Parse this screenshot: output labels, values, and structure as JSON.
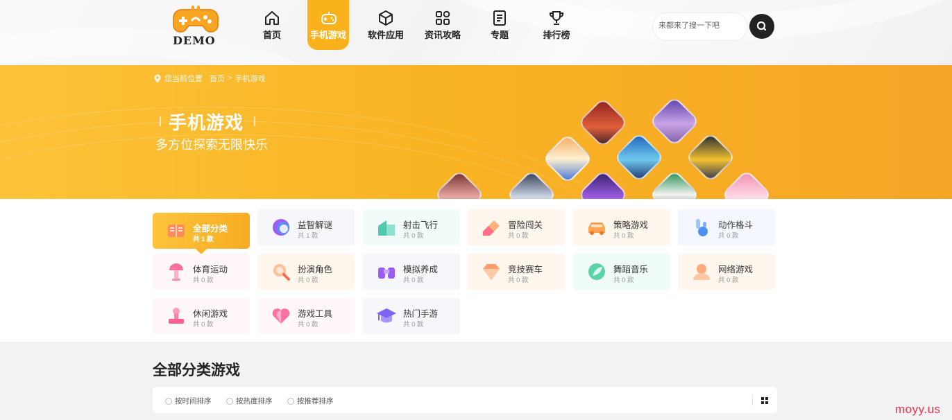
{
  "logo": {
    "text": "DEMO"
  },
  "nav": {
    "items": [
      {
        "label": "首页",
        "icon": "home-icon"
      },
      {
        "label": "手机游戏",
        "icon": "gamepad-icon",
        "active": true
      },
      {
        "label": "软件应用",
        "icon": "box-icon"
      },
      {
        "label": "资讯攻略",
        "icon": "grid-icon"
      },
      {
        "label": "专题",
        "icon": "document-icon"
      },
      {
        "label": "排行榜",
        "icon": "trophy-icon"
      }
    ]
  },
  "search": {
    "placeholder": "来都来了搜一下吧",
    "icon": "search-icon"
  },
  "breadcrumb": {
    "prefix": "您当前位置",
    "home": "首页",
    "separator": ">",
    "current": "手机游戏"
  },
  "banner": {
    "title": "手机游戏",
    "subtitle": "多方位探索无限快乐"
  },
  "categories": [
    {
      "name": "全部分类",
      "count": "共 1 款",
      "active": true,
      "icon": "book-icon"
    },
    {
      "name": "益智解谜",
      "count": "共 1 款",
      "icon": "puzzle-orb-icon"
    },
    {
      "name": "射击飞行",
      "count": "共 0 款",
      "icon": "building-icon"
    },
    {
      "name": "冒险闯关",
      "count": "共 0 款",
      "icon": "eraser-icon"
    },
    {
      "name": "策略游戏",
      "count": "共 0 款",
      "icon": "car-icon"
    },
    {
      "name": "动作格斗",
      "count": "共 0 款",
      "icon": "joystick-icon"
    },
    {
      "name": "体育运动",
      "count": "共 0 款",
      "icon": "lamp-icon"
    },
    {
      "name": "扮演角色",
      "count": "共 0 款",
      "icon": "magnifier-icon"
    },
    {
      "name": "模拟养成",
      "count": "共 0 款",
      "icon": "binoculars-icon"
    },
    {
      "name": "竞技赛车",
      "count": "共 0 款",
      "icon": "diamond-icon"
    },
    {
      "name": "舞蹈音乐",
      "count": "共 0 款",
      "icon": "leaf-icon"
    },
    {
      "name": "网络游戏",
      "count": "共 0 款",
      "icon": "user-icon"
    },
    {
      "name": "休闲游戏",
      "count": "共 0 款",
      "icon": "stamp-icon"
    },
    {
      "name": "游戏工具",
      "count": "共 0 款",
      "icon": "heart-icon"
    },
    {
      "name": "热门手游",
      "count": "共 0 款",
      "icon": "graduation-cap-icon"
    }
  ],
  "section": {
    "title": "全部分类游戏"
  },
  "sort": {
    "options": [
      "按时间排序",
      "按热度排序",
      "按推荐排序"
    ]
  },
  "watermark": "moyy.us",
  "colors": {
    "accent": "#f9b21c",
    "dark": "#222222",
    "brand_red": "#e8304d"
  }
}
